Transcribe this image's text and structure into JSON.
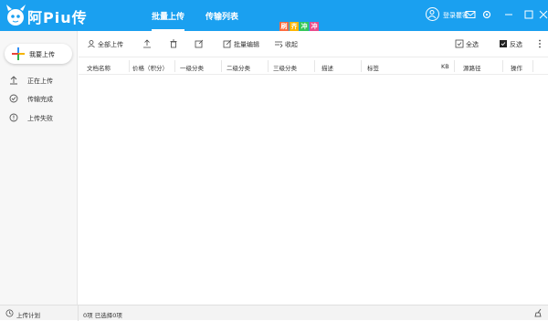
{
  "colors": {
    "accent": "#1aa0f0",
    "white": "#ffffff"
  },
  "app": {
    "brand": "阿Piu传"
  },
  "nav": {
    "tabs": [
      {
        "label": "批量上传",
        "active": true
      },
      {
        "label": "传输列表",
        "active": false
      }
    ]
  },
  "promo": {
    "chars": [
      "刷",
      "齐",
      "冲",
      "冲"
    ]
  },
  "user": {
    "login_label": "登录瞿客"
  },
  "sidebar": {
    "upload_label": "我要上传",
    "items": [
      {
        "label": "正在上传",
        "icon": "upload-arrow-icon"
      },
      {
        "label": "传输完成",
        "icon": "check-circle-icon"
      },
      {
        "label": "上传失败",
        "icon": "error-circle-icon"
      }
    ]
  },
  "toolbar": {
    "upload_all": "全部上传",
    "batch_edit": "批量编辑",
    "collapse": "收起",
    "select_all": "全选",
    "invert": "反选"
  },
  "table": {
    "headers": [
      "文档名称",
      "价格（积分）",
      "一级分类",
      "二级分类",
      "三级分类",
      "描述",
      "标签",
      "KB",
      "源路径",
      "操作"
    ]
  },
  "status": {
    "plan_label": "上传计划",
    "selection": "0项 已选择0项"
  }
}
